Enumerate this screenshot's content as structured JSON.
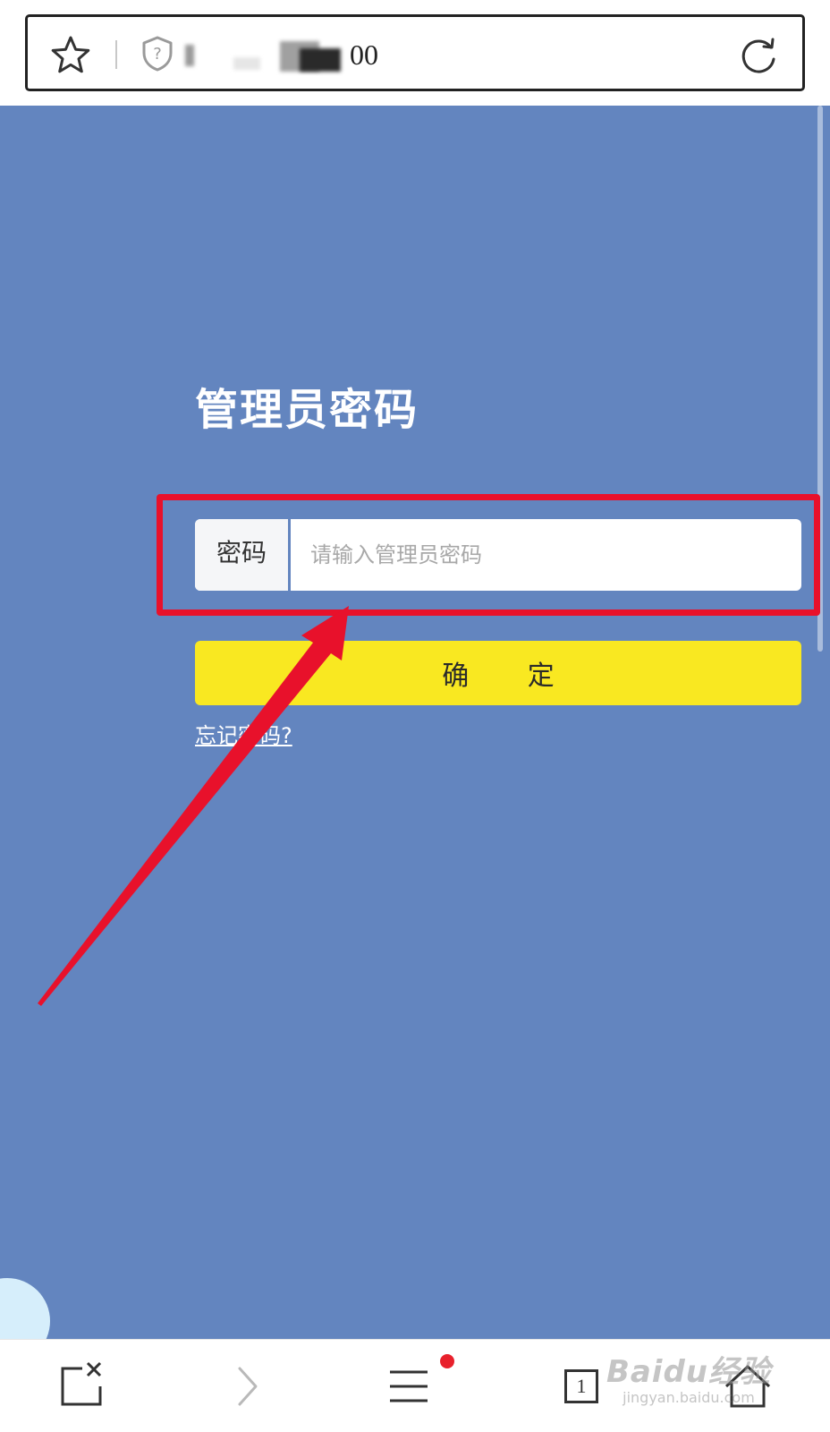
{
  "browser": {
    "url_visible": "00"
  },
  "form": {
    "title": "管理员密码",
    "password_label": "密码",
    "password_placeholder": "请输入管理员密码",
    "confirm_label": "确 定",
    "forgot_link": "忘记密码?"
  },
  "toolbar": {
    "tab_count": "1"
  },
  "watermark": {
    "main": "Baidu经验",
    "sub": "jingyan.baidu.com"
  },
  "colors": {
    "background_blue": "#6385bf",
    "confirm_yellow": "#f9e821",
    "highlight_red": "#e8112b",
    "notification_dot": "#e8212c"
  },
  "icons": [
    "star-icon",
    "shield-icon",
    "reload-icon",
    "close-page-icon",
    "forward-icon",
    "menu-icon",
    "tabs-icon",
    "home-icon"
  ]
}
